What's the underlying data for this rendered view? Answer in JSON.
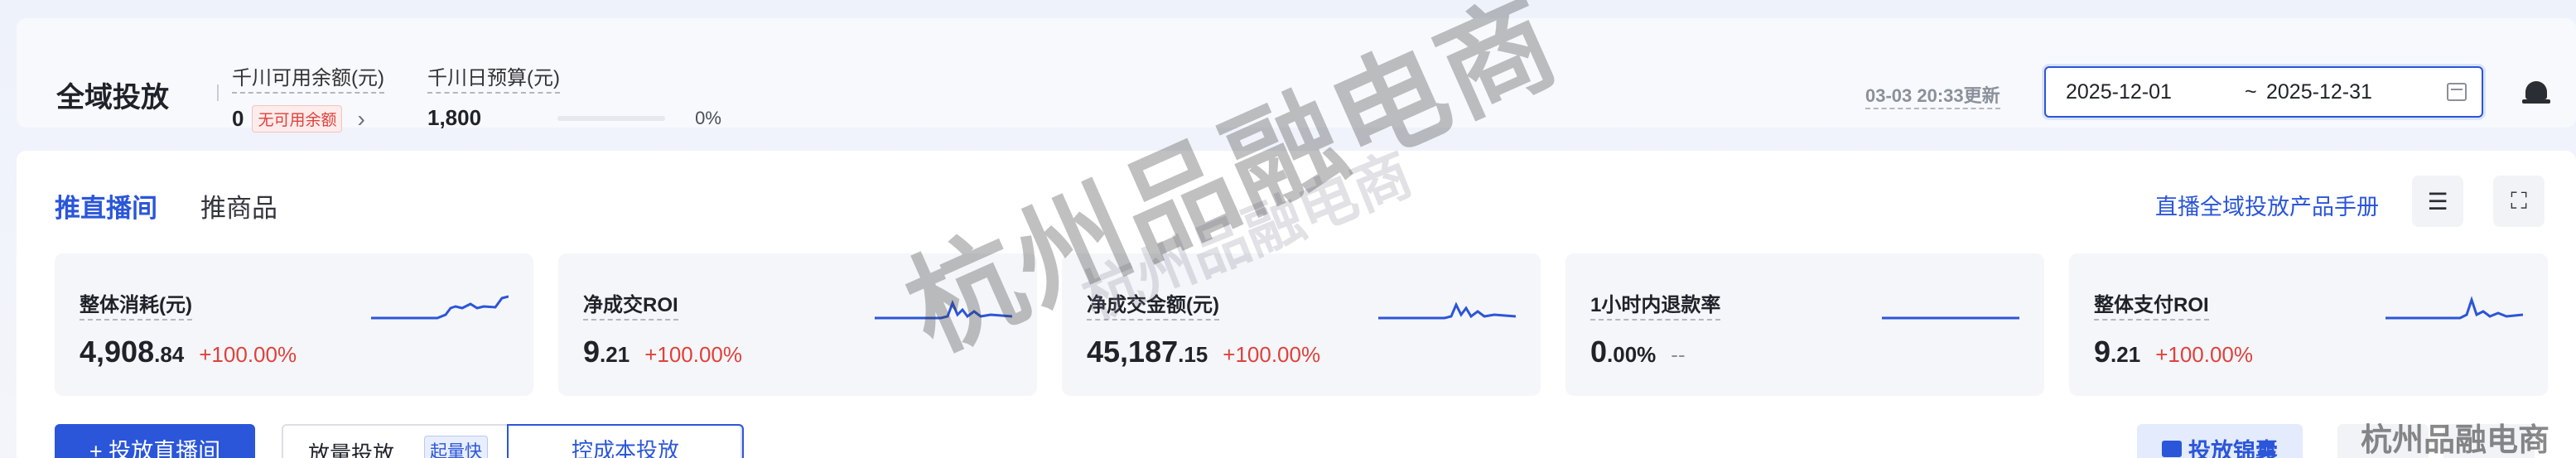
{
  "header": {
    "title": "全域投放",
    "balance_label": "千川可用余额(元)",
    "balance_value": "0",
    "balance_badge": "无可用余额",
    "budget_label": "千川日预算(元)",
    "budget_value": "1,800",
    "budget_progress_fraction": 0,
    "budget_progress_text": "0%",
    "updated_text": "03-03 20:33更新",
    "date_start": "2025-12-01",
    "date_sep": "~",
    "date_end": "2025-12-31"
  },
  "tabs": [
    {
      "label": "推直播间",
      "active": true
    },
    {
      "label": "推商品",
      "active": false
    }
  ],
  "manual_link": "直播全域投放产品手册",
  "kpis": [
    {
      "label": "整体消耗(元)",
      "value_main": "4,908",
      "value_sub": ".84",
      "change": "+100.00%"
    },
    {
      "label": "净成交ROI",
      "value_main": "9",
      "value_sub": ".21",
      "change": "+100.00%"
    },
    {
      "label": "净成交金额(元)",
      "value_main": "45,187",
      "value_sub": ".15",
      "change": "+100.00%"
    },
    {
      "label": "1小时内退款率",
      "value_main": "0",
      "value_sub": ".00%",
      "change": "--"
    },
    {
      "label": "整体支付ROI",
      "value_main": "9",
      "value_sub": ".21",
      "change": "+100.00%"
    }
  ],
  "actions": {
    "primary": "+ 投放直播间",
    "seg_option_a": "放量投放",
    "seg_tag": "起量快",
    "seg_option_b": "控成本投放",
    "brief_label": "投放锦囊"
  },
  "watermark": {
    "big": "杭州品融电商",
    "faint": "杭州品融电商",
    "corner": "杭州品融电商"
  },
  "colors": {
    "accent": "#2b56d9",
    "negative": "#e0413a"
  }
}
